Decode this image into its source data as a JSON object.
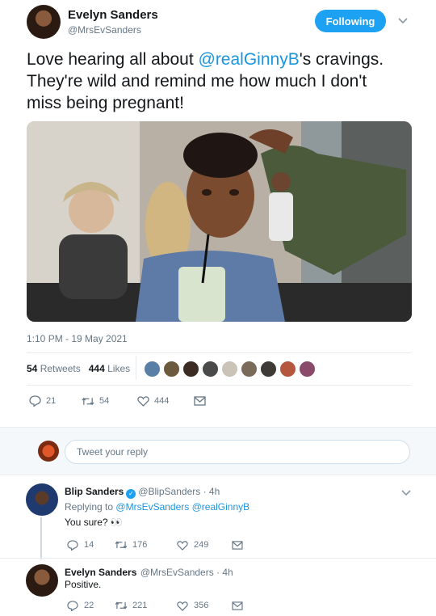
{
  "tweet": {
    "author_name": "Evelyn Sanders",
    "author_handle": "@MrsEvSanders",
    "follow_label": "Following",
    "text_before": "Love hearing all about ",
    "text_mention": "@realGinnyB",
    "text_after": "'s cravings. They're wild and remind me how much I don't miss being pregnant!",
    "timestamp": "1:10 PM - 19 May 2021",
    "retweets_count": "54",
    "retweets_label": "Retweets",
    "likes_count": "444",
    "likes_label": "Likes",
    "actions": {
      "replies": "21",
      "retweets": "54",
      "likes": "444"
    }
  },
  "liker_colors": [
    "#5a7fa6",
    "#6b5a3e",
    "#3b2b22",
    "#4a4a4a",
    "#c9c3b8",
    "#7a6a5a",
    "#3e3a36",
    "#b4573e",
    "#8a4a6a"
  ],
  "reply_box": {
    "placeholder": "Tweet your reply"
  },
  "replies": [
    {
      "name": "Blip Sanders",
      "handle_time": "@BlipSanders · 4h",
      "replying_label": "Replying to",
      "replying_to": "@MrsEvSanders @realGinnyB",
      "text": "You sure? 👀",
      "replies": "14",
      "retweets": "176",
      "likes": "249"
    },
    {
      "name": "Evelyn Sanders",
      "handle_time": "@MrsEvSanders · 4h",
      "text": "Positive.",
      "replies": "22",
      "retweets": "221",
      "likes": "356"
    }
  ],
  "colors": {
    "accent": "#1da1f2",
    "link": "#1b95e0",
    "muted": "#657786"
  }
}
